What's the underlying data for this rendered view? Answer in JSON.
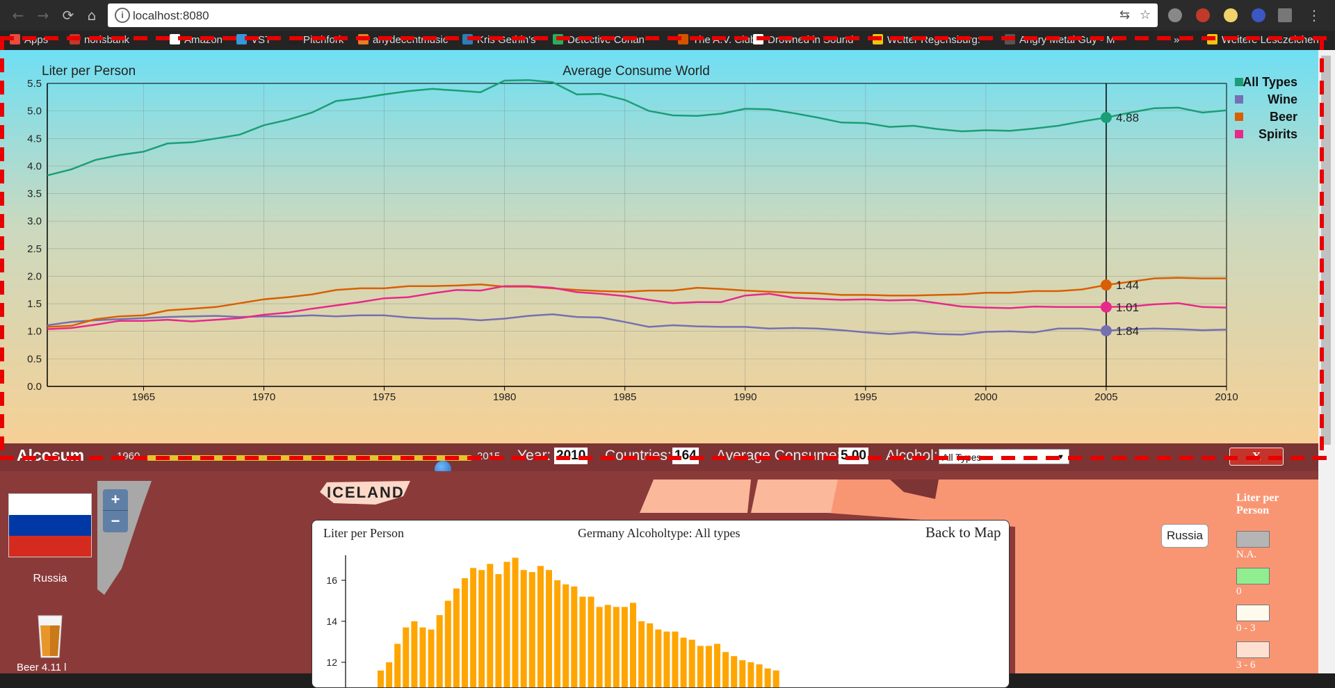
{
  "browser": {
    "url": "localhost:8080",
    "bookmarks": [
      {
        "label": "Apps",
        "color": "#e74c3c"
      },
      {
        "label": "norisbank",
        "color": "#c0392b"
      },
      {
        "label": "Amazon",
        "color": "#ffffff"
      },
      {
        "label": "VST",
        "color": "#3498db"
      },
      {
        "label": "Pitchfork",
        "color": "#222222"
      },
      {
        "label": "anydecentmusic",
        "color": "#e67e22"
      },
      {
        "label": "Kris Gethin's",
        "color": "#2980b9"
      },
      {
        "label": "Detective Conan",
        "color": "#27ae60"
      },
      {
        "label": "The A.V. Club",
        "color": "#d35400"
      },
      {
        "label": "Drowned in Sound",
        "color": "#ffffff"
      },
      {
        "label": "Wetter Regensburg:",
        "color": "#f1c40f"
      },
      {
        "label": "Angry Metal Guy - M",
        "color": "#555555"
      },
      {
        "label": "»",
        "color": ""
      },
      {
        "label": "Weitere Lesezeichen",
        "color": "#f1c40f"
      }
    ]
  },
  "line_chart": {
    "title": "Average Consume World",
    "ylabel": "Liter per Person",
    "legend": [
      {
        "label": "All Types",
        "color": "#1b9e77"
      },
      {
        "label": "Wine",
        "color": "#7570b3"
      },
      {
        "label": "Beer",
        "color": "#d95f02"
      },
      {
        "label": "Spirits",
        "color": "#e7298a"
      }
    ],
    "hover_labels": [
      "4.88",
      "1.84",
      "1.44",
      "1.01"
    ]
  },
  "chart_data": [
    {
      "type": "line",
      "title": "Average Consume World",
      "ylabel": "Liter per Person",
      "xlabel": "",
      "x": [
        1961,
        1962,
        1963,
        1964,
        1965,
        1966,
        1967,
        1968,
        1969,
        1970,
        1971,
        1972,
        1973,
        1974,
        1975,
        1976,
        1977,
        1978,
        1979,
        1980,
        1981,
        1982,
        1983,
        1984,
        1985,
        1986,
        1987,
        1988,
        1989,
        1990,
        1991,
        1992,
        1993,
        1994,
        1995,
        1996,
        1997,
        1998,
        1999,
        2000,
        2001,
        2002,
        2003,
        2004,
        2005,
        2006,
        2007,
        2008,
        2009,
        2010
      ],
      "xlim": [
        1961,
        2010
      ],
      "ylim": [
        0,
        5.5
      ],
      "x_ticks": [
        1965,
        1970,
        1975,
        1980,
        1985,
        1990,
        1995,
        2000,
        2005,
        2010
      ],
      "y_ticks": [
        0.0,
        0.5,
        1.0,
        1.5,
        2.0,
        2.5,
        3.0,
        3.5,
        4.0,
        4.5,
        5.0,
        5.5
      ],
      "grid": true,
      "legend_position": "right",
      "hover_year": 2005,
      "series": [
        {
          "name": "All Types",
          "color": "#1b9e77",
          "values": [
            3.83,
            3.94,
            4.11,
            4.2,
            4.26,
            4.41,
            4.43,
            4.5,
            4.57,
            4.74,
            4.84,
            4.97,
            5.18,
            5.23,
            5.3,
            5.36,
            5.4,
            5.37,
            5.34,
            5.55,
            5.56,
            5.52,
            5.3,
            5.31,
            5.2,
            5.0,
            4.92,
            4.91,
            4.95,
            5.04,
            5.03,
            4.96,
            4.88,
            4.79,
            4.78,
            4.71,
            4.73,
            4.67,
            4.63,
            4.65,
            4.64,
            4.68,
            4.73,
            4.81,
            4.88,
            4.97,
            5.05,
            5.06,
            4.97,
            5.01
          ]
        },
        {
          "name": "Wine",
          "color": "#7570b3",
          "values": [
            1.11,
            1.17,
            1.2,
            1.22,
            1.24,
            1.26,
            1.27,
            1.28,
            1.26,
            1.27,
            1.27,
            1.29,
            1.27,
            1.29,
            1.29,
            1.25,
            1.23,
            1.23,
            1.2,
            1.23,
            1.28,
            1.31,
            1.26,
            1.25,
            1.17,
            1.08,
            1.11,
            1.09,
            1.08,
            1.08,
            1.05,
            1.06,
            1.05,
            1.02,
            0.98,
            0.95,
            0.98,
            0.95,
            0.94,
            0.99,
            1.0,
            0.98,
            1.05,
            1.05,
            1.01,
            1.04,
            1.05,
            1.04,
            1.02,
            1.03
          ]
        },
        {
          "name": "Beer",
          "color": "#d95f02",
          "values": [
            1.08,
            1.1,
            1.22,
            1.27,
            1.29,
            1.38,
            1.41,
            1.44,
            1.51,
            1.58,
            1.62,
            1.67,
            1.75,
            1.78,
            1.78,
            1.82,
            1.82,
            1.83,
            1.85,
            1.81,
            1.81,
            1.78,
            1.75,
            1.73,
            1.72,
            1.74,
            1.74,
            1.79,
            1.77,
            1.74,
            1.72,
            1.7,
            1.69,
            1.66,
            1.66,
            1.65,
            1.65,
            1.66,
            1.67,
            1.7,
            1.7,
            1.73,
            1.73,
            1.76,
            1.84,
            1.9,
            1.96,
            1.97,
            1.96,
            1.96
          ]
        },
        {
          "name": "Spirits",
          "color": "#e7298a",
          "values": [
            1.04,
            1.06,
            1.12,
            1.19,
            1.19,
            1.21,
            1.18,
            1.21,
            1.24,
            1.3,
            1.34,
            1.41,
            1.47,
            1.53,
            1.6,
            1.62,
            1.69,
            1.75,
            1.74,
            1.82,
            1.82,
            1.79,
            1.71,
            1.68,
            1.64,
            1.57,
            1.51,
            1.53,
            1.53,
            1.65,
            1.68,
            1.61,
            1.59,
            1.57,
            1.58,
            1.56,
            1.57,
            1.51,
            1.45,
            1.43,
            1.42,
            1.45,
            1.44,
            1.44,
            1.44,
            1.45,
            1.49,
            1.51,
            1.44,
            1.43
          ]
        }
      ]
    },
    {
      "type": "bar",
      "title": "Germany Alcoholtype: All types",
      "ylabel": "Liter per Person",
      "xlabel": "",
      "y_ticks": [
        12,
        14,
        16
      ],
      "grid": false,
      "values": [
        11.6,
        12.0,
        12.9,
        13.7,
        14.0,
        13.7,
        13.6,
        14.3,
        15.0,
        15.6,
        16.1,
        16.6,
        16.5,
        16.8,
        16.3,
        16.9,
        17.1,
        16.5,
        16.4,
        16.7,
        16.5,
        16.0,
        15.8,
        15.7,
        15.2,
        15.2,
        14.7,
        14.8,
        14.7,
        14.7,
        14.9,
        14.0,
        13.9,
        13.6,
        13.5,
        13.5,
        13.2,
        13.1,
        12.8,
        12.8,
        12.9,
        12.5,
        12.3,
        12.1,
        12.0,
        11.9,
        11.7,
        11.6
      ]
    }
  ],
  "control_bar": {
    "app_title": "Alcosum",
    "slider_min": "1960",
    "slider_max": "2015",
    "slider_value": 2010,
    "year_label": "Year:",
    "year_value": "2010",
    "countries_label": "Countries:",
    "countries_value": "164",
    "avg_label": "Average Consume:",
    "avg_value": "5.00",
    "alcohol_label": "Alcohol:",
    "alcohol_selected": "All Types",
    "close_label": "X"
  },
  "map": {
    "zoom_in": "+",
    "zoom_out": "−",
    "iceland_label": "ICELAND",
    "selected_country": "Russia",
    "country_button": "Russia",
    "drink_label": "Beer 4.11 l",
    "legend_title": "Liter per Person",
    "legend_items": [
      {
        "label": "N.A.",
        "color": "#b5b5b5"
      },
      {
        "label": "0",
        "color": "#90ee90"
      },
      {
        "label": "0 - 3",
        "color": "#fffaee"
      },
      {
        "label": "3 - 6",
        "color": "#fde0d0"
      }
    ]
  },
  "modal": {
    "ylabel": "Liter per Person",
    "title": "Germany Alcoholtype: All types",
    "back_label": "Back to Map"
  }
}
